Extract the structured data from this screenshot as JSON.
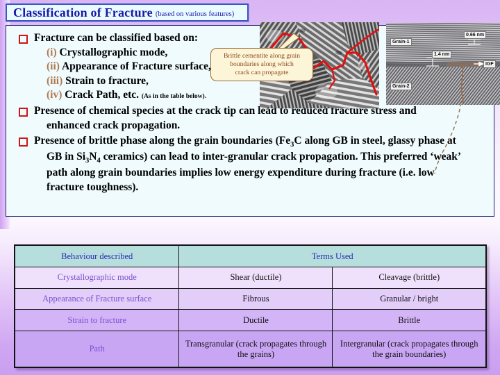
{
  "slide": {
    "title_main": "Classification of Fracture",
    "title_sub": "(based on various features)"
  },
  "content": {
    "bullets": [
      {
        "line1": "Fracture can be classified based on:",
        "items": [
          {
            "roman": "(i)",
            "text": "Crystallographic mode,"
          },
          {
            "roman": "(ii)",
            "text": "Appearance of Fracture surface,"
          },
          {
            "roman": "(iii)",
            "text": "Strain to fracture,"
          },
          {
            "roman": "(iv)",
            "text": "Crack Path, etc.",
            "note": "(As in the table below)."
          }
        ]
      },
      {
        "text_a": "Presence of chemical species at the crack tip can lead to reduced fracture stress and",
        "text_b": "enhanced crack propagation."
      },
      {
        "text_a": "Presence of brittle phase along the grain boundaries (Fe",
        "sub_a": "3",
        "text_b": "C along GB in steel, glassy phase at",
        "text_c": "GB in Si",
        "sub_b": "3",
        "text_d": "N",
        "sub_c": "4",
        "text_e": " ceramics) can lead to inter-granular crack propagation. This preferred ‘weak’",
        "text_f": "path along grain boundaries implies low energy expenditure during fracture (i.e. low",
        "text_g": "fracture toughness)."
      }
    ]
  },
  "callout": {
    "line1": "Brittle cementite along grain",
    "line2": "boundaries along which",
    "line3": "crack can propagate"
  },
  "micrograph_left": {
    "caption": "fracture surface micrograph with red traced intergranular crack path"
  },
  "micrograph_right": {
    "labels": {
      "grain1": "Grain-1",
      "grain2": "Grain-2",
      "d1": "0.66 nm",
      "d2": "1.4 nm",
      "igf": "IGF"
    }
  },
  "table": {
    "headers": [
      "Behaviour described",
      "Terms Used"
    ],
    "rows": [
      {
        "label": "Crystallographic mode",
        "c2": "Shear (ductile)",
        "c3": "Cleavage (brittle)"
      },
      {
        "label": "Appearance of Fracture surface",
        "c2": "Fibrous",
        "c3": "Granular / bright"
      },
      {
        "label": "Strain to fracture",
        "c2": "Ductile",
        "c3": "Brittle"
      },
      {
        "label": "Path",
        "c2": "Transgranular (crack propagates through the grains)",
        "c3": "Intergranular (crack propagates through the grain boundaries)"
      }
    ]
  },
  "colors": {
    "slide_bg_top": "#d9b5f4",
    "slide_bg_bottom": "#c9a0f0",
    "title_text": "#1a18a8",
    "title_bg": "#e9fbff",
    "title_border": "#3a56c8",
    "content_bg": "#effbfd",
    "content_border": "#1a1a6e",
    "bullet_square": "#d01515",
    "roman_numeral": "#b07a52",
    "callout_bg": "#fdf5d8",
    "callout_border": "#9a6a33",
    "callout_text": "#8a4a20",
    "table_header_bg": "#b6dedd",
    "table_header_text": "#2a2ab4",
    "table_label_text": "#7a4fd0",
    "crack_trace": "#e01010"
  }
}
